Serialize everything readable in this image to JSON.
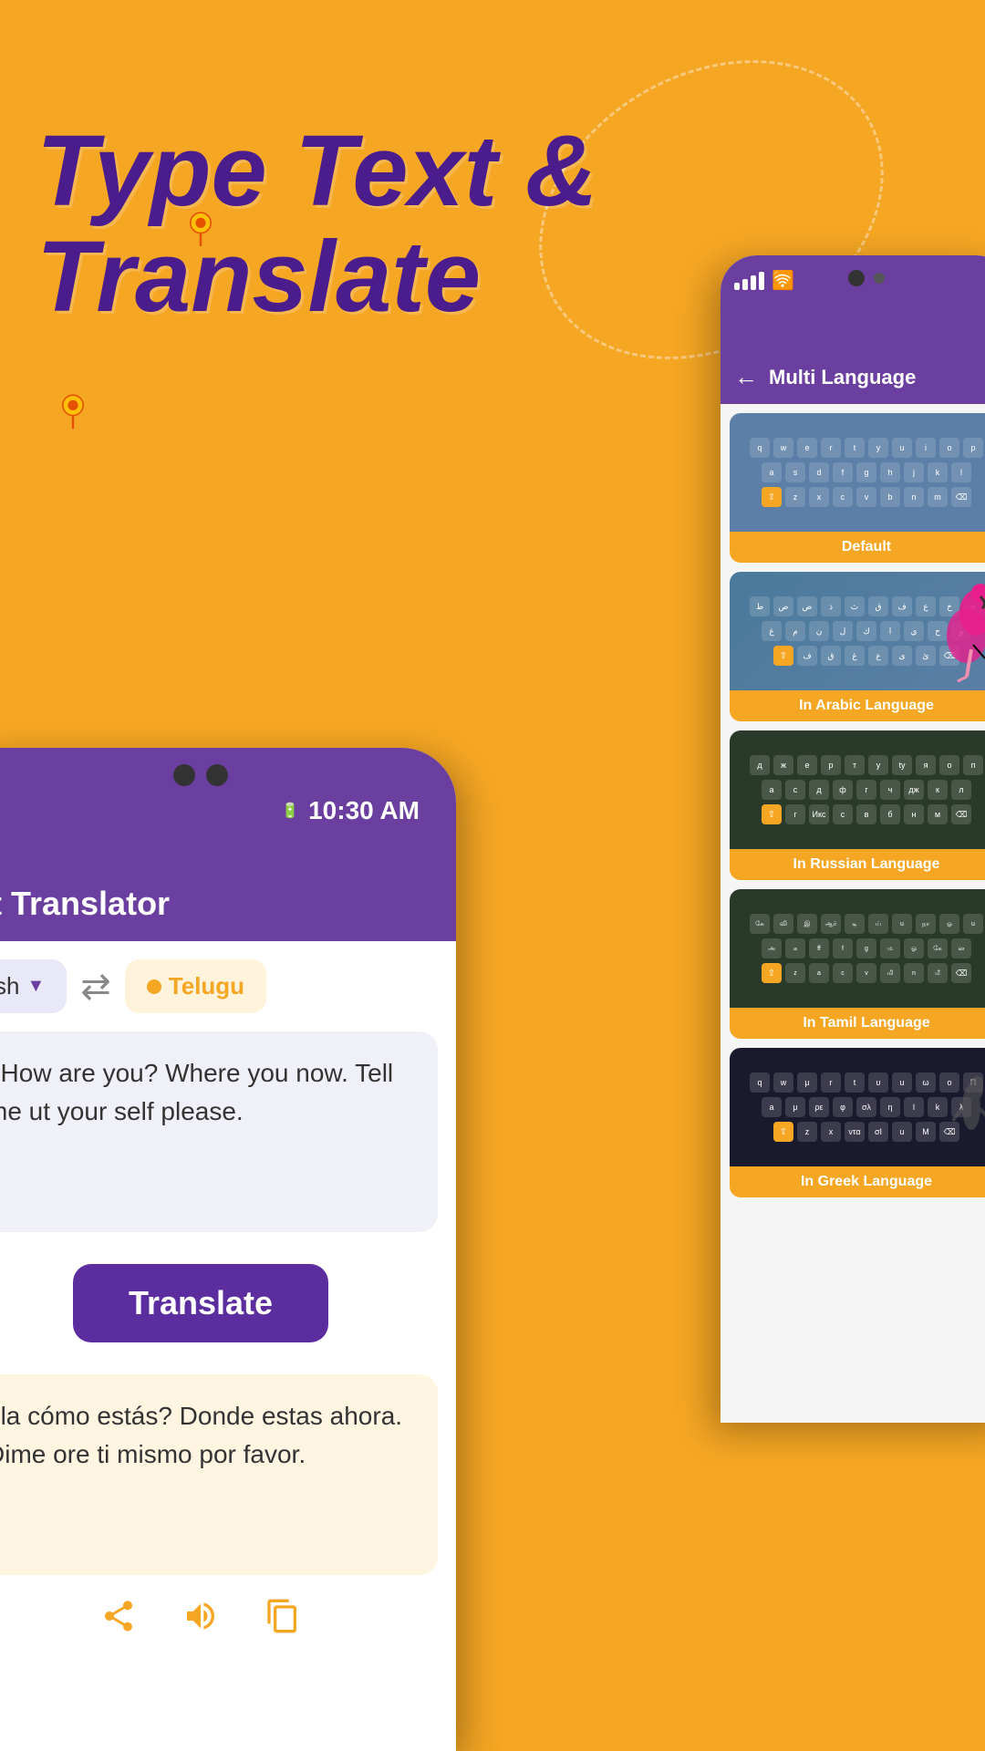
{
  "page": {
    "background_color": "#F5A623"
  },
  "headline": {
    "line1": "Type Text &",
    "line2": "Translate"
  },
  "left_phone": {
    "status": {
      "time": "10:30 AM",
      "battery": "🔋"
    },
    "app_title": "xt Translator",
    "source_lang": "sh",
    "source_dropdown": "▼",
    "shuffle_label": "⇄",
    "target_lang": "Telugu",
    "input_text": ", How are you? Where you now. Tell me ut your self please.",
    "translate_button": "Translate",
    "output_text": "ola cómo estás? Donde estas ahora. Dime ore ti mismo por favor.",
    "action_icons": {
      "share": "share",
      "volume": "volume",
      "copy": "copy"
    }
  },
  "right_phone": {
    "status": {
      "signal": "||||",
      "wifi": "wifi"
    },
    "header": {
      "back": "←",
      "title": "Multi Language"
    },
    "keyboards": [
      {
        "id": "default",
        "label": "Default",
        "type": "latin",
        "rows": [
          [
            "q",
            "w",
            "e",
            "r",
            "t",
            "y",
            "u",
            "i",
            "o",
            "p"
          ],
          [
            "a",
            "s",
            "d",
            "f",
            "g",
            "h",
            "j",
            "k",
            "l"
          ],
          [
            "⇧",
            "z",
            "x",
            "c",
            "v",
            "b",
            "n",
            "m",
            "⌫"
          ]
        ]
      },
      {
        "id": "arabic",
        "label": "In Arabic Language",
        "type": "arabic",
        "rows": [
          [
            "ط",
            "ص",
            "ض",
            "ذ",
            "خ",
            "ث",
            "ق",
            "ف",
            "غ",
            "ع"
          ],
          [
            "غ",
            "م",
            "ن",
            "ل",
            "ك",
            "ي",
            "ح",
            "ج",
            "و"
          ],
          [
            "⇧",
            "ف",
            "ق",
            "غ",
            "ع",
            "ى",
            "ئ",
            "⌫"
          ]
        ]
      },
      {
        "id": "russian",
        "label": "In Russian Language",
        "type": "cyrillic",
        "rows": [
          [
            "д",
            "ж",
            "е",
            "р",
            "т",
            "у",
            "tу",
            "я",
            "о",
            "п"
          ],
          [
            "а",
            "с",
            "д",
            "ф",
            "г",
            "час",
            "дж",
            "к",
            "л"
          ],
          [
            "⇧",
            "г",
            "Икс",
            "с",
            "в",
            "б",
            "н",
            "м",
            "⌫"
          ]
        ]
      },
      {
        "id": "tamil",
        "label": "In Tamil Language",
        "type": "tamil",
        "rows": [
          [
            "கே",
            "வி",
            "இ",
            "ஆர்",
            "டி",
            "ய்",
            "u",
            "நா",
            "ஓ",
            "u"
          ],
          [
            "அ",
            "க",
            "ff",
            "f",
            "g",
            "ம",
            "ஓ",
            "கே",
            "ன"
          ],
          [
            "⇧",
            "z",
            "a",
            "c",
            "v",
            "மி",
            "n",
            "மீ",
            "⌫"
          ]
        ]
      },
      {
        "id": "greek",
        "label": "In Greek Language",
        "type": "greek",
        "rows": [
          [
            "q",
            "w",
            "μ",
            "r",
            "t",
            "υ",
            "u",
            "ω",
            "o",
            "Π"
          ],
          [
            "a",
            "μ",
            "ρε",
            "φ",
            "σλ",
            "η",
            "l",
            "k",
            "λ"
          ],
          [
            "⇧",
            "z",
            "x",
            "ντα",
            "σΙ",
            "u",
            "M",
            "⌫"
          ]
        ]
      }
    ]
  }
}
